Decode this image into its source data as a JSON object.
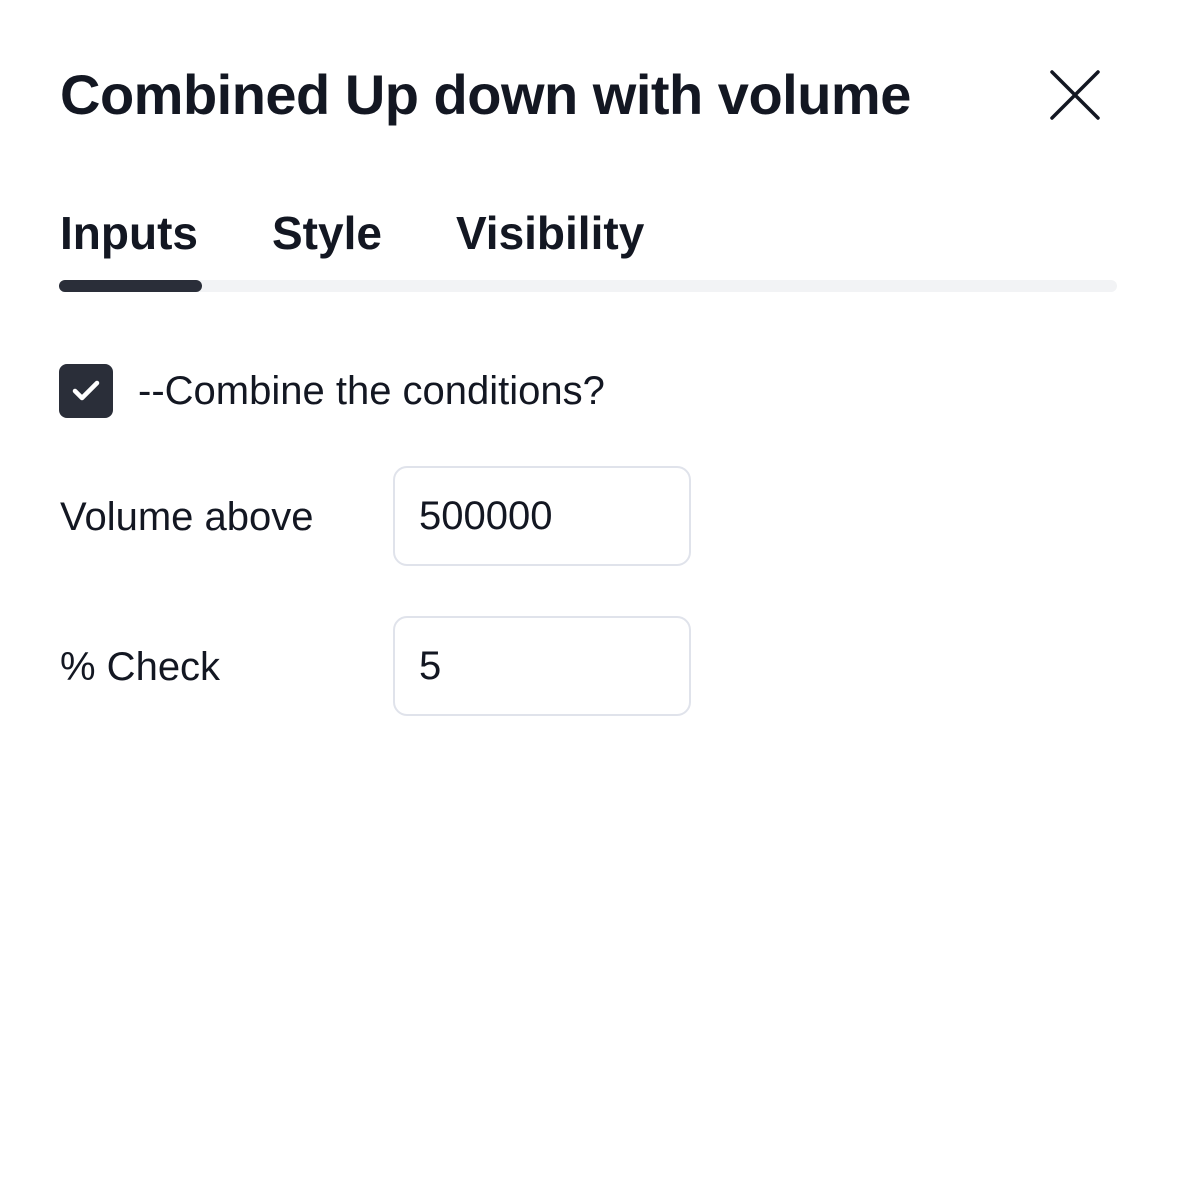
{
  "dialog": {
    "title": "Combined Up down with volume",
    "close_icon": "close-icon"
  },
  "tabs": [
    {
      "label": "Inputs",
      "active": true
    },
    {
      "label": "Style",
      "active": false
    },
    {
      "label": "Visibility",
      "active": false
    }
  ],
  "inputs": {
    "combine": {
      "label": "--Combine the conditions?",
      "checked": true,
      "icon": "checkmark-icon"
    },
    "volume_above": {
      "label": "Volume above",
      "value": "500000"
    },
    "percent_check": {
      "label": "% Check",
      "value": "5"
    }
  },
  "colors": {
    "text": "#131722",
    "accent_dark": "#2a2e39",
    "track": "#f2f3f5",
    "input_border": "#e0e3eb"
  }
}
